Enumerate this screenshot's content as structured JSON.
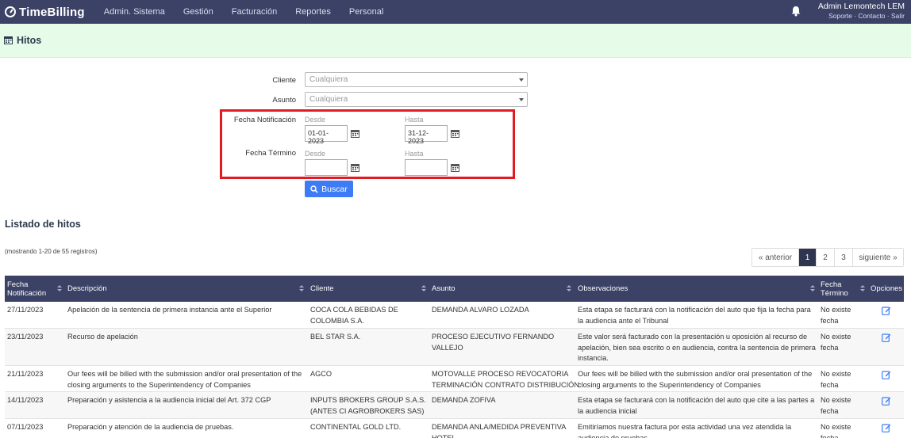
{
  "nav": {
    "brand": "TimeBilling",
    "items": [
      "Admin. Sistema",
      "Gestión",
      "Facturación",
      "Reportes",
      "Personal"
    ],
    "user_name": "Admin Lemontech LEM",
    "user_links": "Soporte · Contacto · Salir"
  },
  "header": {
    "title": "Hitos"
  },
  "filters": {
    "cliente_label": "Cliente",
    "cliente_value": "Cualquiera",
    "asunto_label": "Asunto",
    "asunto_value": "Cualquiera",
    "fecha_notificacion_label": "Fecha Notificación",
    "fecha_termino_label": "Fecha Término",
    "desde_label": "Desde",
    "hasta_label": "Hasta",
    "notif_desde": "01-01-2023",
    "notif_hasta": "31-12-2023",
    "term_desde": "",
    "term_hasta": "",
    "search_button": "Buscar"
  },
  "listing": {
    "title": "Listado de hitos",
    "records": "(mostrando 1-20 de 55 registros)",
    "pagination": [
      "« anterior",
      "1",
      "2",
      "3",
      "siguiente »"
    ],
    "active_page": "1"
  },
  "table": {
    "headers": {
      "fecha_notif_1": "Fecha",
      "fecha_notif_2": "Notificación",
      "descripcion": "Descripción",
      "cliente": "Cliente",
      "asunto": "Asunto",
      "observaciones": "Observaciones",
      "fecha_term_1": "Fecha",
      "fecha_term_2": "Término",
      "opciones": "Opciones"
    },
    "rows": [
      {
        "fecha": "27/11/2023",
        "descripcion": [
          "Apelación de la sentencia de primera instancia ante el Superior"
        ],
        "cliente": [
          "COCA COLA BEBIDAS DE",
          "COLOMBIA S.A."
        ],
        "asunto": [
          "DEMANDA ALVARO LOZADA"
        ],
        "observaciones": [
          "Esta etapa se facturará con la notificación del auto que fija la fecha para",
          "la audiencia ante el Tribunal"
        ],
        "termino": [
          "No existe",
          "fecha"
        ]
      },
      {
        "fecha": "23/11/2023",
        "descripcion": [
          "Recurso de apelación"
        ],
        "cliente": [
          "BEL STAR S.A."
        ],
        "asunto": [
          "PROCESO EJECUTIVO FERNANDO",
          "VALLEJO"
        ],
        "observaciones": [
          "Este valor será facturado con la presentación u oposición al recurso de",
          "apelación, bien sea escrito o en audiencia, contra la sentencia de primera",
          "instancia."
        ],
        "termino": [
          "No existe",
          "fecha"
        ]
      },
      {
        "fecha": "21/11/2023",
        "descripcion": [
          "Our fees will be billed with the submission and/or oral presentation of the",
          "closing arguments to the Superintendency of Companies"
        ],
        "cliente": [
          "AGCO"
        ],
        "asunto": [
          "MOTOVALLE PROCESO REVOCATORIA",
          "TERMINACIÓN CONTRATO DISTRIBUCIÓN"
        ],
        "observaciones": [
          "Our fees will be billed with the submission and/or oral presentation of the",
          "closing arguments to the Superintendency of Companies"
        ],
        "termino": [
          "No existe",
          "fecha"
        ]
      },
      {
        "fecha": "14/11/2023",
        "descripcion": [
          "Preparación y asistencia a la audiencia inicial del Art. 372 CGP"
        ],
        "cliente": [
          "INPUTS BROKERS GROUP S.A.S.",
          "(ANTES CI AGROBROKERS SAS)"
        ],
        "asunto": [
          "DEMANDA ZOFIVA"
        ],
        "observaciones": [
          "Esta etapa se facturará con la notificación del auto que cite a las partes a",
          "la audiencia inicial"
        ],
        "termino": [
          "No existe",
          "fecha"
        ]
      },
      {
        "fecha": "07/11/2023",
        "descripcion": [
          "Preparación y atención de la audiencia de pruebas."
        ],
        "cliente": [
          "CONTINENTAL GOLD LTD."
        ],
        "asunto": [
          "DEMANDA ANLA/MEDIDA PREVENTIVA",
          "HOTEL"
        ],
        "observaciones": [
          "Emitiríamos nuestra factura por esta actividad una vez atendida la",
          "audiencia de pruebas."
        ],
        "termino": [
          "No existe",
          "fecha"
        ]
      }
    ]
  },
  "colors": {
    "nav_bg": "#3b4266",
    "header_band": "#e6fbe8",
    "accent": "#3e7cf5",
    "highlight": "#e01b22"
  }
}
